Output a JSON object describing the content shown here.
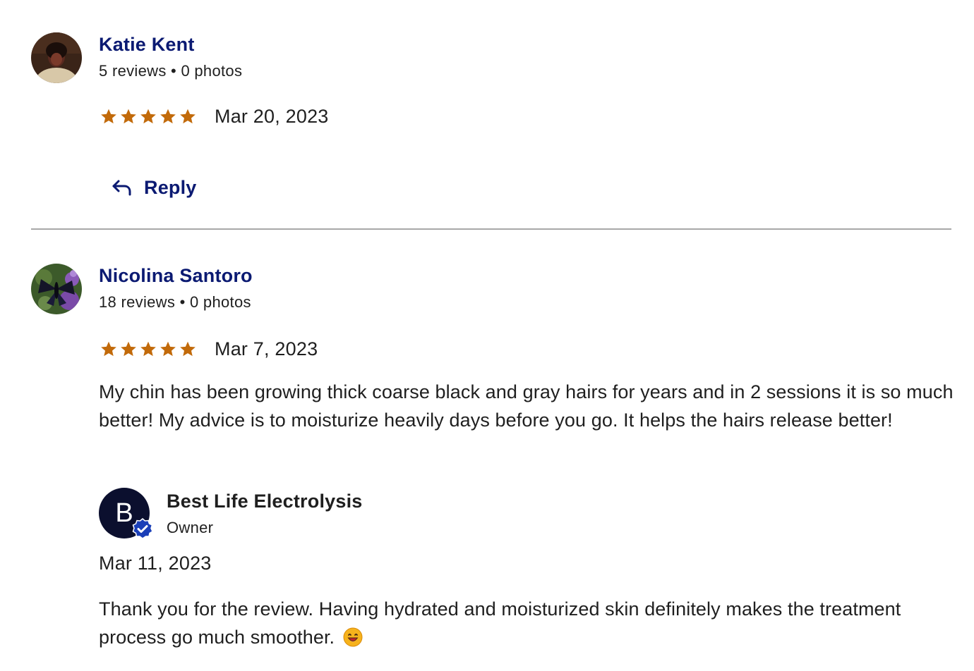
{
  "colors": {
    "author_link": "#0b1a72",
    "star": "#c26a0a",
    "divider": "#a8a8a8",
    "owner_avatar_bg": "#0b0f2e",
    "verified_badge": "#1a3fb8"
  },
  "reviews": [
    {
      "author": "Katie Kent",
      "meta": "5 reviews • 0 photos",
      "rating": 5,
      "date": "Mar 20, 2023",
      "reply_label": "Reply",
      "avatar_icon": "user-photo"
    },
    {
      "author": "Nicolina Santoro",
      "meta": "18 reviews • 0 photos",
      "rating": 5,
      "date": "Mar 7, 2023",
      "text": "My chin has been growing thick coarse black and gray hairs for years and in 2 sessions it is so much better! My advice is to moisturize heavily days before you go. It helps the hairs release better!",
      "avatar_icon": "butterfly-photo",
      "owner_response": {
        "avatar_letter": "B",
        "name": "Best Life Electrolysis",
        "role": "Owner",
        "date": "Mar 11, 2023",
        "text": "Thank you for the review. Having hydrated and moisturized skin definitely makes the treatment process go much smoother.",
        "emoji_icon": "smiling-face-emoji",
        "badge_icon": "verified-check-icon"
      }
    }
  ]
}
